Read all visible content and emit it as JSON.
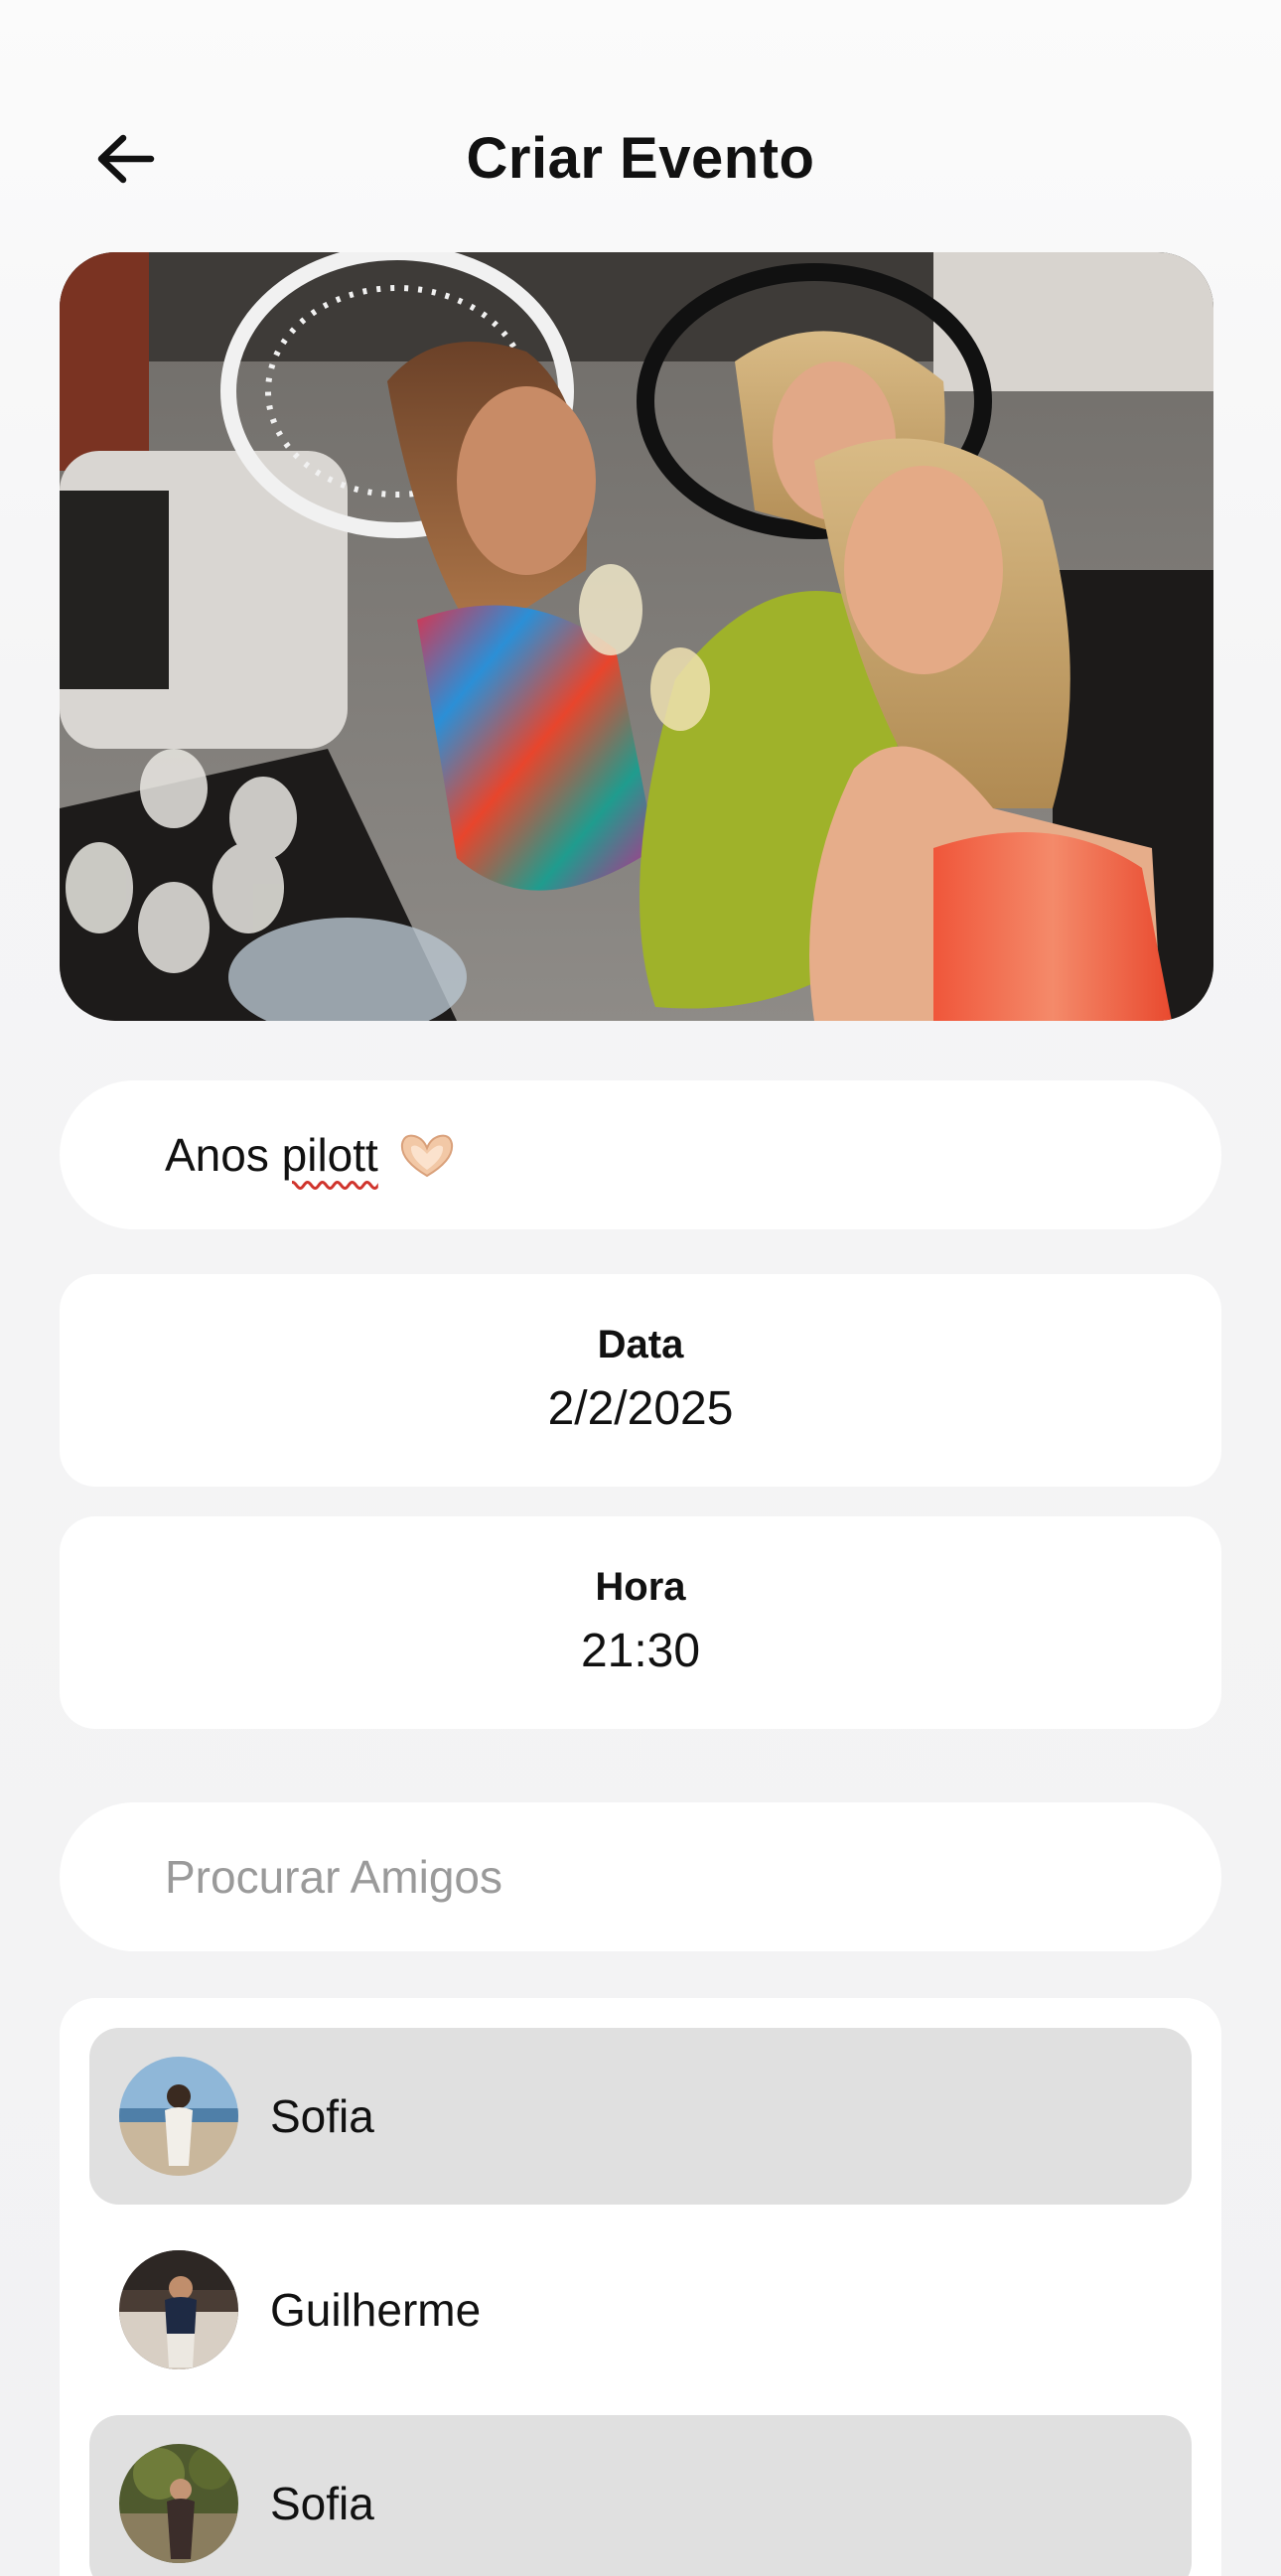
{
  "header": {
    "title": "Criar Evento",
    "back_icon": "arrow-left-icon"
  },
  "event": {
    "name_value": "Anos",
    "name_misspelled": "pilott",
    "name_emoji": "heart-hands-emoji"
  },
  "date": {
    "label": "Data",
    "value": "2/2/2025"
  },
  "time": {
    "label": "Hora",
    "value": "21:30"
  },
  "search": {
    "placeholder": "Procurar Amigos"
  },
  "friends": [
    {
      "name": "Sofia",
      "selected": true
    },
    {
      "name": "Guilherme",
      "selected": false
    },
    {
      "name": "Sofia",
      "selected": true
    }
  ],
  "colors": {
    "background": "#f3f3f4",
    "card": "#ffffff",
    "selected_row": "#e0e0e0",
    "placeholder": "#9a9a9a",
    "spellcheck": "#d0342c"
  }
}
